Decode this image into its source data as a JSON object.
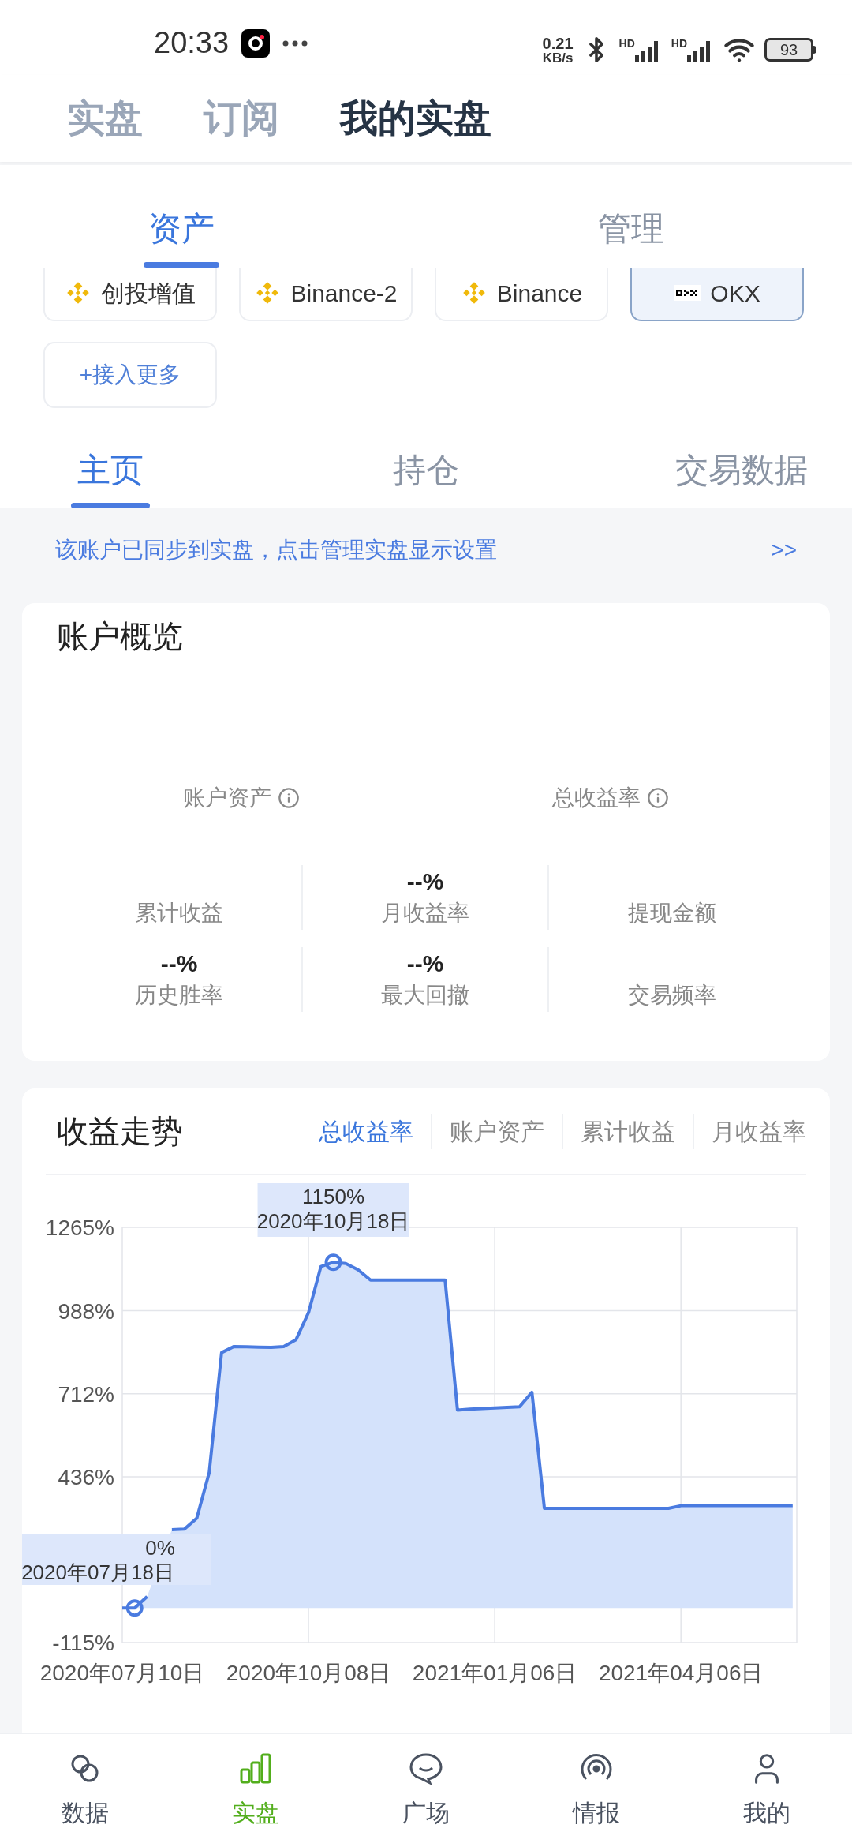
{
  "status_bar": {
    "time": "20:33",
    "net_speed": "0.21",
    "net_unit": "KB/s",
    "signals": [
      "HD",
      "HD"
    ],
    "battery": "93"
  },
  "top_tabs": [
    {
      "label": "实盘",
      "selected": false
    },
    {
      "label": "订阅",
      "selected": false
    },
    {
      "label": "我的实盘",
      "selected": true
    }
  ],
  "asset_tabs": [
    {
      "label": "资产",
      "selected": true
    },
    {
      "label": "管理",
      "selected": false
    }
  ],
  "accounts": [
    {
      "label": "创投增值",
      "kind": "binance",
      "selected": false
    },
    {
      "label": "Binance-2",
      "kind": "binance",
      "selected": false
    },
    {
      "label": "Binance",
      "kind": "binance",
      "selected": false
    },
    {
      "label": "OKX",
      "kind": "okx",
      "selected": true
    }
  ],
  "add_account": "+接入更多",
  "page_tabs": [
    {
      "label": "主页",
      "selected": true
    },
    {
      "label": "持仓",
      "selected": false
    },
    {
      "label": "交易数据",
      "selected": false
    }
  ],
  "notice": {
    "text": "该账户已同步到实盘，点击管理实盘显示设置",
    "link": ">>"
  },
  "overview": {
    "title": "账户概览",
    "headline_stats": [
      {
        "label": "账户资产"
      },
      {
        "label": "总收益率"
      }
    ],
    "stats": [
      {
        "label": "累计收益"
      },
      {
        "label": "月收益率",
        "value": "--%"
      },
      {
        "label": "提现金额"
      },
      {
        "label": "历史胜率",
        "value": "--%"
      },
      {
        "label": "最大回撤",
        "value": "--%"
      },
      {
        "label": "交易频率"
      }
    ]
  },
  "trend": {
    "title": "收益走势",
    "metric_tabs": [
      {
        "label": "总收益率",
        "selected": true
      },
      {
        "label": "账户资产",
        "selected": false
      },
      {
        "label": "累计收益",
        "selected": false
      },
      {
        "label": "月收益率",
        "selected": false
      }
    ],
    "chart_data": {
      "type": "area",
      "categories": [
        "2020年07月10日",
        null,
        null,
        null,
        null,
        null,
        null,
        null,
        null,
        null,
        null,
        null,
        null,
        null,
        null,
        "2020年10月08日",
        null,
        null,
        null,
        null,
        null,
        null,
        null,
        null,
        null,
        null,
        null,
        null,
        null,
        null,
        "2021年01月06日",
        null,
        null,
        null,
        null,
        null,
        null,
        null,
        null,
        null,
        null,
        null,
        null,
        null,
        null,
        "2021年04月06日",
        null,
        null,
        null,
        null,
        null,
        null,
        null,
        null,
        null
      ],
      "series": [
        {
          "color": "#4a7be0",
          "values": [
            0,
            0,
            38,
            null,
            260,
            262,
            298,
            450,
            849,
            869,
            868,
            867,
            866,
            869,
            892,
            982,
            1135,
            1149,
            1145,
            1124,
            1090,
            1090,
            1090,
            1090,
            1090,
            1090,
            1090,
            658,
            661,
            663,
            665,
            667,
            669,
            717,
            331,
            331,
            331,
            331,
            331,
            331,
            331,
            331,
            331,
            331,
            331,
            340,
            340,
            340,
            340,
            340,
            340,
            340,
            340,
            340,
            340
          ]
        }
      ],
      "ylim": [
        -115,
        1265
      ],
      "grid": true,
      "yticks": [
        {
          "value": -115,
          "label": "-115%"
        },
        {
          "value": 436,
          "label": "436%"
        },
        {
          "value": 712,
          "label": "712%"
        },
        {
          "value": 988,
          "label": "988%"
        },
        {
          "value": 1265,
          "label": "1265%"
        }
      ],
      "annotations": [
        {
          "text": "1150%\n2020年10月18日"
        },
        {
          "text": "0%\n2020年07月18日"
        }
      ]
    }
  },
  "bottom_nav": [
    {
      "label": "数据",
      "selected": false
    },
    {
      "label": "实盘",
      "selected": true
    },
    {
      "label": "广场",
      "selected": false
    },
    {
      "label": "情报",
      "selected": false
    },
    {
      "label": "我的",
      "selected": false
    }
  ]
}
